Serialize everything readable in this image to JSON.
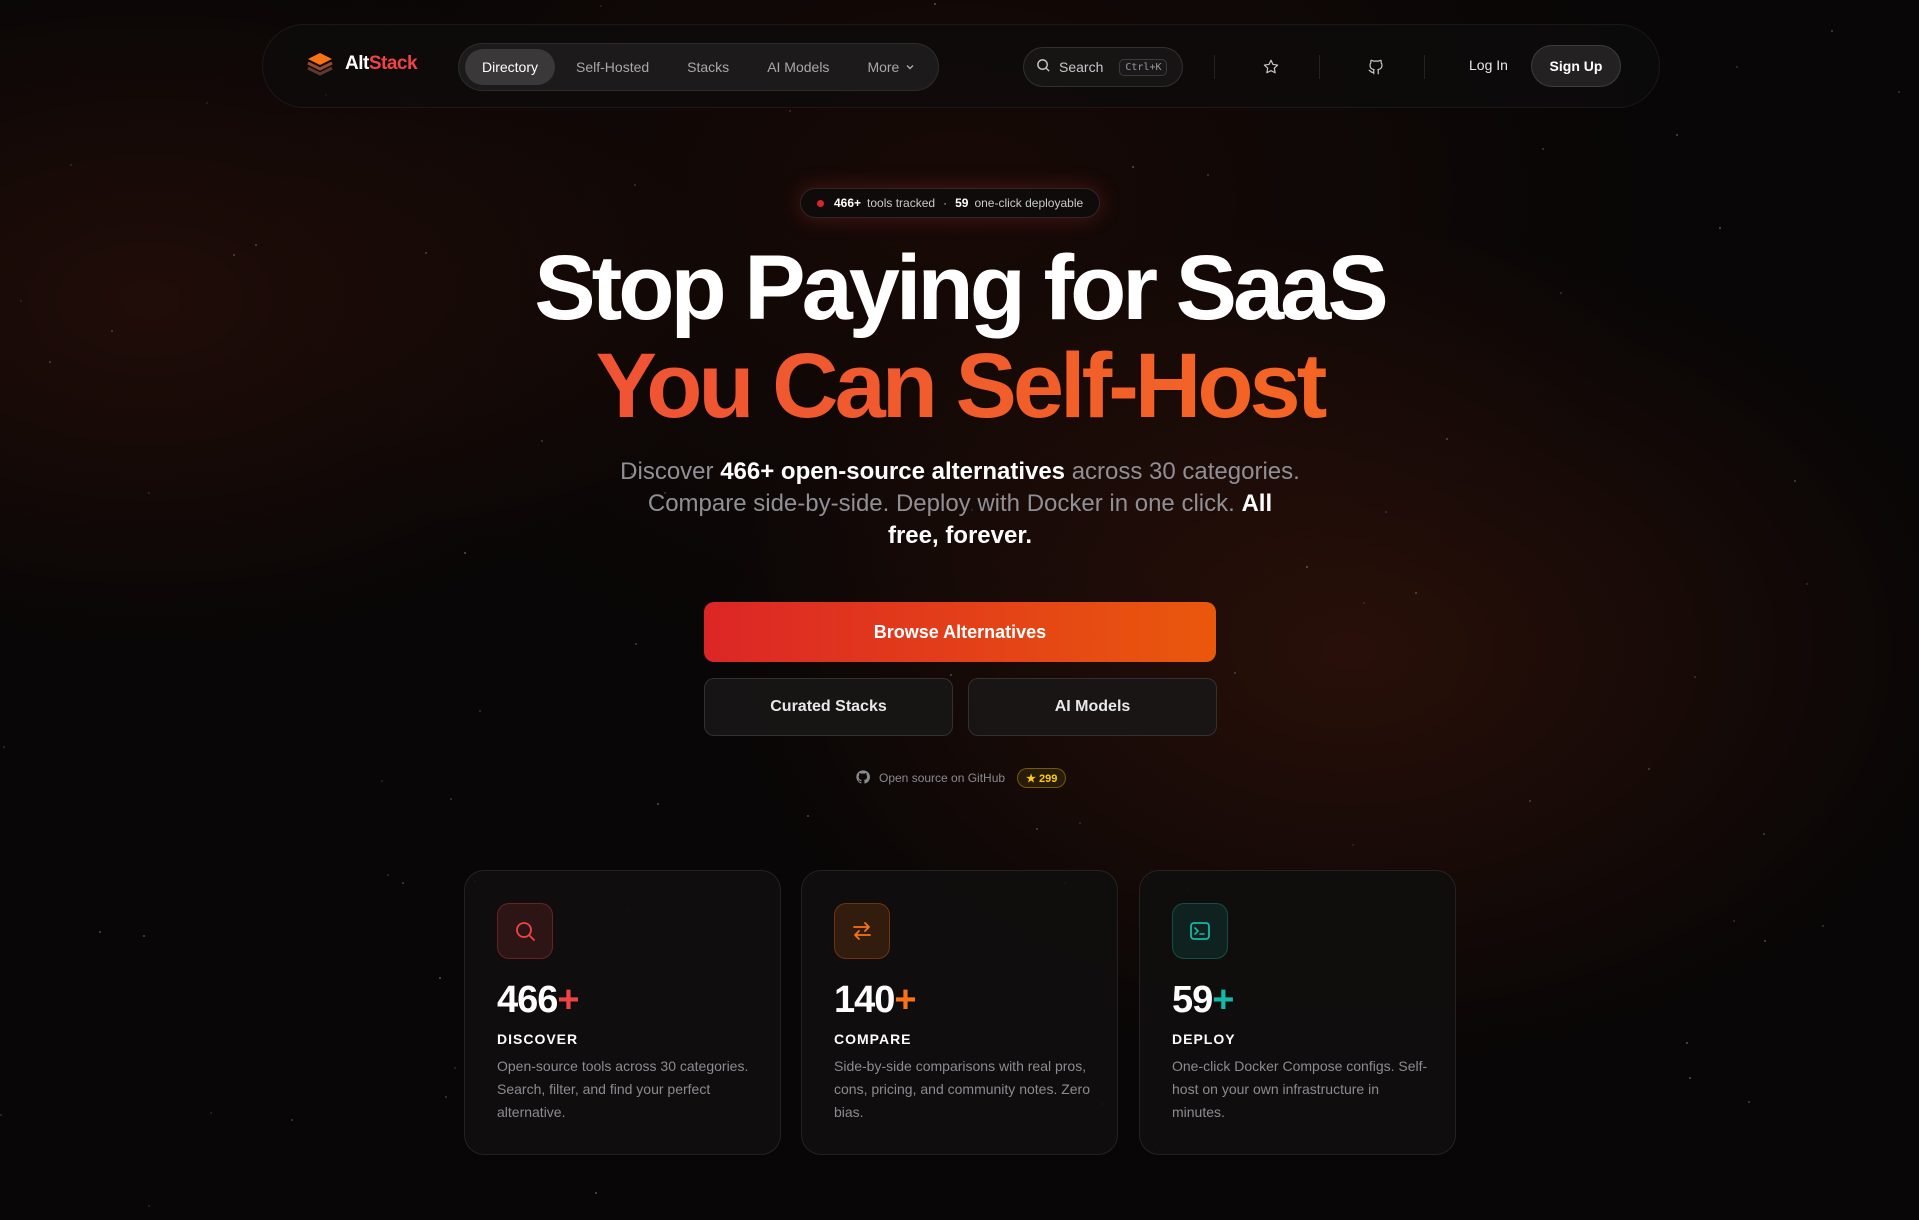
{
  "brand": {
    "part1": "Alt",
    "part2": "Stack"
  },
  "nav": {
    "items": [
      {
        "label": "Directory",
        "active": true
      },
      {
        "label": "Self-Hosted"
      },
      {
        "label": "Stacks"
      },
      {
        "label": "AI Models"
      },
      {
        "label": "More"
      }
    ],
    "search_label": "Search",
    "search_shortcut": "Ctrl+K",
    "login": "Log In",
    "signup": "Sign Up"
  },
  "badge": {
    "count": "466+",
    "count_suffix": "tools tracked",
    "separator": "·",
    "deploy": "59",
    "deploy_suffix": "one-click deployable"
  },
  "hero": {
    "line1": "Stop Paying for SaaS",
    "line2": "You Can Self-Host"
  },
  "subtitle": {
    "p1": "Discover ",
    "b1": "466+ open-source alternatives",
    "p2": " across 30 categories. Compare side-by-side. Deploy with Docker in one click. ",
    "b2": "All free, forever."
  },
  "cta": {
    "primary": "Browse Alternatives",
    "secondary1": "Curated Stacks",
    "secondary2": "AI Models"
  },
  "github": {
    "label": "Open source on GitHub",
    "stars": "★ 299"
  },
  "features": [
    {
      "num": "466",
      "plus": "+",
      "label": "DISCOVER",
      "desc": "Open-source tools across 30 categories. Search, filter, and find your perfect alternative.",
      "icon": "search-icon",
      "accent": "#ef4444"
    },
    {
      "num": "140",
      "plus": "+",
      "label": "COMPARE",
      "desc": "Side-by-side comparisons with real pros, cons, pricing, and community notes. Zero bias.",
      "icon": "arrows-swap-icon",
      "accent": "#f97316"
    },
    {
      "num": "59",
      "plus": "+",
      "label": "DEPLOY",
      "desc": "One-click Docker Compose configs. Self-host on your own infrastructure in minutes.",
      "icon": "terminal-icon",
      "accent": "#14b8a6"
    }
  ]
}
